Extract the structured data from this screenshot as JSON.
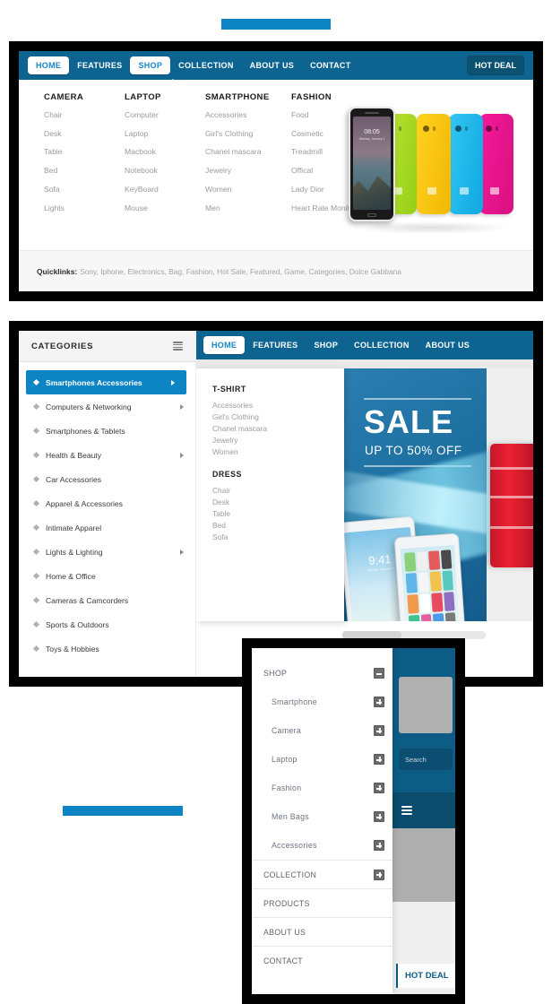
{
  "theme": {
    "accent_blue": "#0d85c4",
    "nav_blue": "#0e6490",
    "hot_deal_blue": "#0b5272",
    "muted_text": "#9a9a9a"
  },
  "mega_menu": {
    "nav": [
      {
        "label": "HOME",
        "style": "pill"
      },
      {
        "label": "FEATURES",
        "style": "plain"
      },
      {
        "label": "SHOP",
        "style": "pill"
      },
      {
        "label": "COLLECTION",
        "style": "plain"
      },
      {
        "label": "ABOUT US",
        "style": "plain"
      },
      {
        "label": "CONTACT",
        "style": "plain"
      }
    ],
    "hot_deal": "HOT DEAL",
    "columns": [
      {
        "title": "CAMERA",
        "links": [
          "Chair",
          "Desk",
          "Table",
          "Bed",
          "Sofa",
          "Lights"
        ]
      },
      {
        "title": "LAPTOP",
        "links": [
          "Computer",
          "Laptop",
          "Macbook",
          "Notebook",
          "KeyBoard",
          "Mouse"
        ]
      },
      {
        "title": "SMARTPHONE",
        "links": [
          "Accessories",
          "Girl's Clothing",
          "Chanel mascara",
          "Jewelry",
          "Women",
          "Men"
        ]
      },
      {
        "title": "FASHION",
        "links": [
          "Food",
          "Cosmetic",
          "Treadmill",
          "Offical",
          "Lady Dior",
          "Heart Rate Monitor"
        ]
      }
    ],
    "promo_image_alt": "smartphone-color-lineup",
    "phone_clock": "08:05",
    "phone_clock_sub": "Monday, January 1",
    "quicklinks_label": "Quicklinks:",
    "quicklinks": "Sony, Iphone, Electronics, Bag, Fashion, Hot Sale, Featured, Game, Categories, Dolce Gabbana"
  },
  "sidebar_panel": {
    "categories_title": "CATEGORIES",
    "categories": [
      {
        "label": "Smartphones Accessories",
        "has_arrow": true,
        "active": true
      },
      {
        "label": "Computers & Networking",
        "has_arrow": true,
        "active": false
      },
      {
        "label": "Smartphones & Tablets",
        "has_arrow": false,
        "active": false
      },
      {
        "label": "Health & Beauty",
        "has_arrow": true,
        "active": false
      },
      {
        "label": "Car Accessories",
        "has_arrow": false,
        "active": false
      },
      {
        "label": "Apparel & Accessories",
        "has_arrow": false,
        "active": false
      },
      {
        "label": "Intimate Apparel",
        "has_arrow": false,
        "active": false
      },
      {
        "label": "Lights & Lighting",
        "has_arrow": true,
        "active": false
      },
      {
        "label": "Home & Office",
        "has_arrow": false,
        "active": false
      },
      {
        "label": "Cameras & Camcorders",
        "has_arrow": false,
        "active": false
      },
      {
        "label": "Sports & Outdoors",
        "has_arrow": false,
        "active": false
      },
      {
        "label": "Toys & Hobbies",
        "has_arrow": false,
        "active": false
      }
    ],
    "nav": [
      {
        "label": "HOME",
        "style": "pill"
      },
      {
        "label": "FEATURES",
        "style": "plain"
      },
      {
        "label": "SHOP",
        "style": "plain"
      },
      {
        "label": "COLLECTION",
        "style": "plain"
      },
      {
        "label": "ABOUT US",
        "style": "plain"
      }
    ],
    "dropdown": {
      "group1_title": "T-SHIRT",
      "group1_links": [
        "Accessories",
        "Girl's Clothing",
        "Chanel mascara",
        "Jewelry",
        "Women"
      ],
      "group2_title": "DRESS",
      "group2_links": [
        "Chair",
        "Desk",
        "Table",
        "Bed",
        "Sofa"
      ]
    },
    "hero": {
      "headline": "SALE",
      "subline": "UP TO 50% OFF",
      "tablet_time": "9:41",
      "tablet_date": "Monday, January 1",
      "image_alt": "tablets-and-red-accessory"
    }
  },
  "mobile_panel": {
    "menu": [
      {
        "label": "SHOP",
        "level": "top",
        "toggle": "minus",
        "divider": false
      },
      {
        "label": "Smartphone",
        "level": "sub",
        "toggle": "plus",
        "divider": false
      },
      {
        "label": "Camera",
        "level": "sub",
        "toggle": "plus",
        "divider": false
      },
      {
        "label": "Laptop",
        "level": "sub",
        "toggle": "plus",
        "divider": false
      },
      {
        "label": "Fashion",
        "level": "sub",
        "toggle": "plus",
        "divider": false
      },
      {
        "label": "Men Bags",
        "level": "sub",
        "toggle": "plus",
        "divider": false
      },
      {
        "label": "Accessories",
        "level": "sub",
        "toggle": "plus",
        "divider": false
      },
      {
        "label": "COLLECTION",
        "level": "top",
        "toggle": "plus",
        "divider": true
      },
      {
        "label": "PRODUCTS",
        "level": "top",
        "toggle": "none",
        "divider": true
      },
      {
        "label": "ABOUT US",
        "level": "top",
        "toggle": "none",
        "divider": true
      },
      {
        "label": "CONTACT",
        "level": "top",
        "toggle": "none",
        "divider": true
      }
    ],
    "search_placeholder": "Search",
    "hot_deal": "HOT DEAL"
  }
}
